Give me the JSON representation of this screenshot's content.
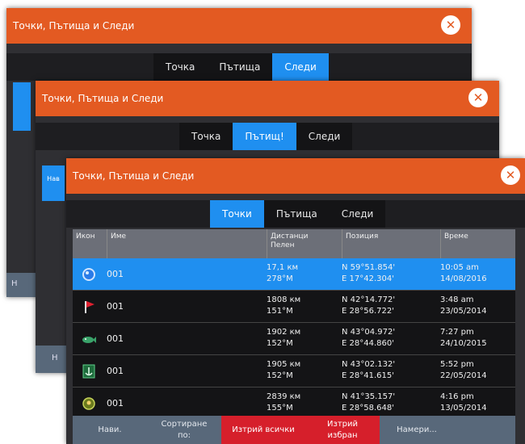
{
  "colors": {
    "accent_orange": "#e35a22",
    "tab_active": "#1f8ff0",
    "danger_red": "#d61f2b"
  },
  "dialog_back": {
    "title": "Точки, Пътища и Следи",
    "tabs": [
      "Точка",
      "Пътища",
      "Следи"
    ],
    "active_tab": "Следи"
  },
  "dialog_middle": {
    "title": "Точки, Пътища и Следи",
    "tabs": [
      "Точка",
      "Пътищ!",
      "Следи"
    ],
    "active_tab": "Пътищ!"
  },
  "dialog_front": {
    "title": "Точки, Пътища и Следи",
    "tabs": [
      "Точки",
      "Пътища",
      "Следи"
    ],
    "active_tab": "Точки",
    "side_stub_label": "Нав",
    "columns": [
      "Икон",
      "Име",
      "Дистанци\nПелен",
      "Позиция",
      "Време"
    ],
    "rows": [
      {
        "icon": "blue-circle-icon",
        "name": "001",
        "distance": "17,1 км",
        "bearing": "278°M",
        "lat": "N  59°51.854'",
        "lon": "E  17°42.304'",
        "time": "10:05 am",
        "date": "14/08/2016",
        "selected": true
      },
      {
        "icon": "red-flag-icon",
        "name": "001",
        "distance": "1808 км",
        "bearing": "151°M",
        "lat": "N  42°14.772'",
        "lon": "E  28°56.722'",
        "time": "3:48 am",
        "date": "23/05/2014",
        "selected": false
      },
      {
        "icon": "fish-icon",
        "name": "001",
        "distance": "1902 км",
        "bearing": "152°M",
        "lat": "N  43°04.972'",
        "lon": "E  28°44.860'",
        "time": "7:27 pm",
        "date": "24/10/2015",
        "selected": false
      },
      {
        "icon": "anchor-icon",
        "name": "001",
        "distance": "1905 км",
        "bearing": "152°M",
        "lat": "N  43°02.132'",
        "lon": "E  28°41.615'",
        "time": "5:52 pm",
        "date": "22/05/2014",
        "selected": false
      },
      {
        "icon": "diver-icon",
        "name": "001",
        "distance": "2839 км",
        "bearing": "155°M",
        "lat": "N  41°35.157'",
        "lon": "E  28°58.648'",
        "time": "4:16 pm",
        "date": "13/05/2014",
        "selected": false
      }
    ],
    "footer": {
      "nav": "Нави.",
      "sort": "Сортиране\nпо:",
      "delete_all": "Изтрий всички",
      "delete_selected": "Изтрий\nизбран",
      "filter": "Намери..."
    }
  },
  "back_footer_stub": "Н",
  "middle_footer_stub": "Н"
}
